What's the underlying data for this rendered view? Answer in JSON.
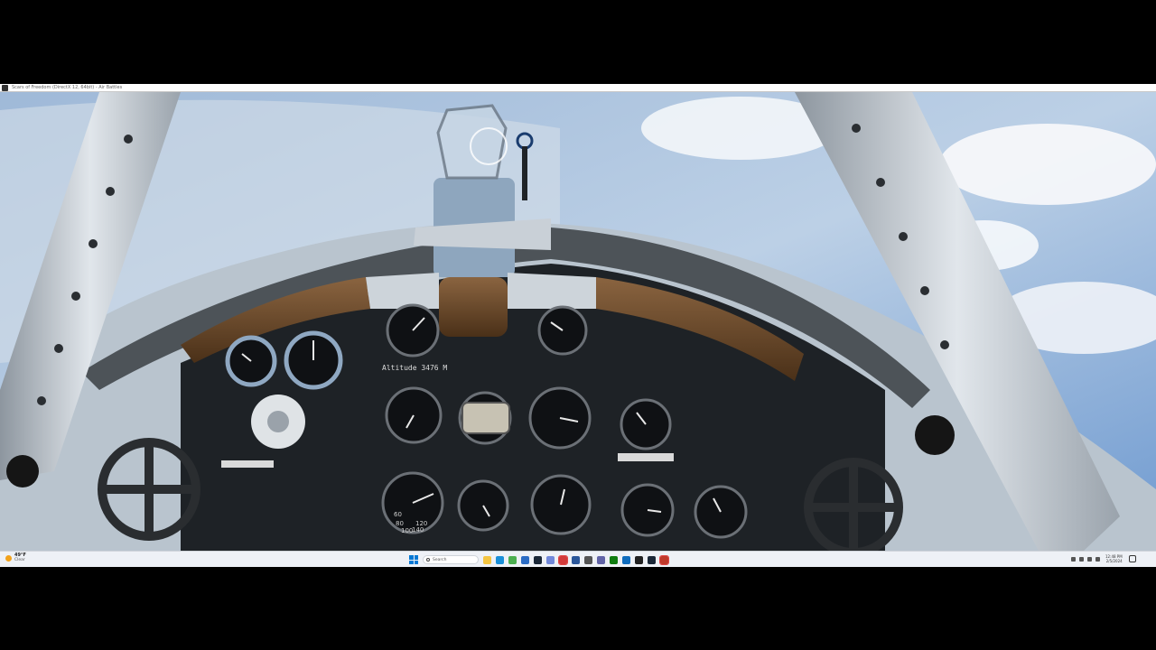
{
  "window": {
    "title": "Scars of Freedom (DirectX 12, 64bit) - Air Battles"
  },
  "cockpit": {
    "altitude_label": "Altitude 3476 M",
    "gauges": {
      "speed_marks": [
        "60",
        "80",
        "100",
        "120",
        "140"
      ]
    }
  },
  "taskbar": {
    "weather": {
      "temp": "49°F",
      "condition": "Clear"
    },
    "search_placeholder": "Search",
    "clock": {
      "time": "12:48 PM",
      "date": "2/5/2024"
    },
    "apps": [
      {
        "name": "file-explorer-icon",
        "color": "#f4c542"
      },
      {
        "name": "edge-icon",
        "color": "#1a8fd8"
      },
      {
        "name": "chrome-icon",
        "color": "#4caf50"
      },
      {
        "name": "store-icon",
        "color": "#2b6cc4"
      },
      {
        "name": "steam-icon",
        "color": "#1b2838"
      },
      {
        "name": "discord-icon",
        "color": "#7289da"
      },
      {
        "name": "game-icon",
        "color": "#d23a3a"
      },
      {
        "name": "word-icon",
        "color": "#2b579a"
      },
      {
        "name": "settings-icon",
        "color": "#555555"
      },
      {
        "name": "teams-icon",
        "color": "#6264a7"
      },
      {
        "name": "xbox-icon",
        "color": "#107c10"
      },
      {
        "name": "outlook-icon",
        "color": "#0f6cbd"
      },
      {
        "name": "media-icon",
        "color": "#222222"
      },
      {
        "name": "steam-icon-2",
        "color": "#1b2838"
      },
      {
        "name": "active-app-icon",
        "color": "#c0392b"
      }
    ]
  },
  "colors": {
    "sky": "#7ea6d4",
    "panel": "#1e2226",
    "frame": "#c3cbd3",
    "leather": "#6b4a2b"
  }
}
